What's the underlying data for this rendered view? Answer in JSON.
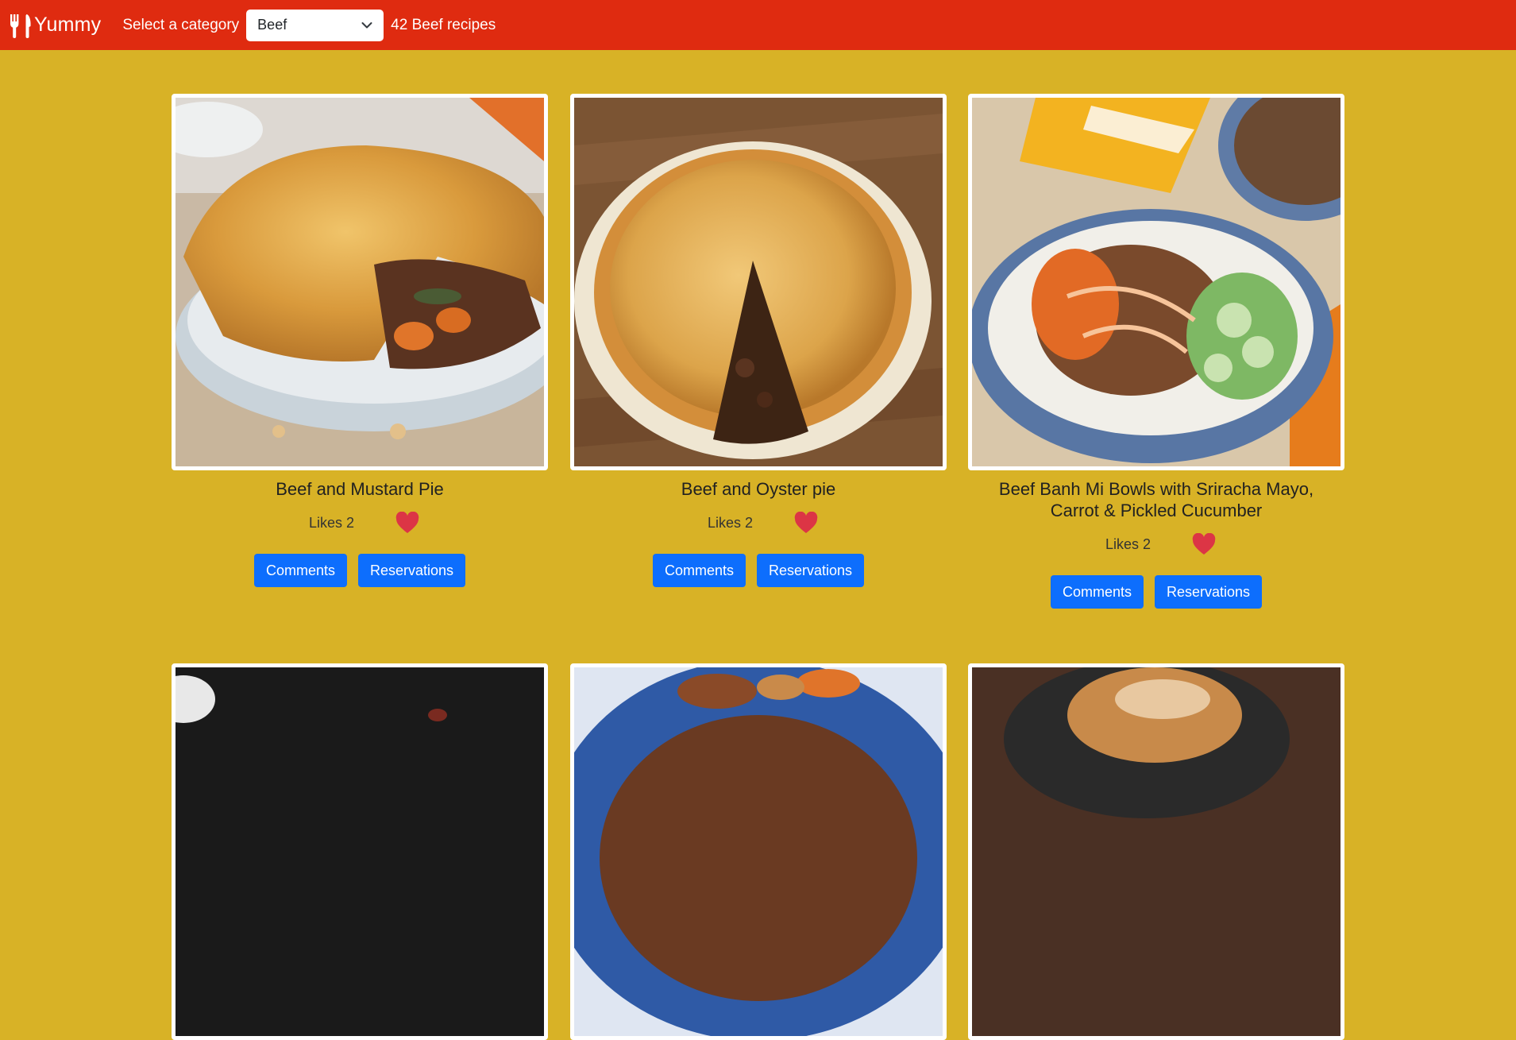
{
  "header": {
    "brand": "Yummy",
    "category_label": "Select a category",
    "category_selected": "Beef",
    "recipe_count_text": "42 Beef recipes",
    "colors": {
      "header_bg": "#df2b10",
      "page_bg": "#d8b226",
      "button": "#0d6efd",
      "heart": "#dc3545"
    }
  },
  "icons": {
    "logo": "fork-knife-icon",
    "dropdown": "chevron-down-icon",
    "like": "heart-icon"
  },
  "meals": [
    {
      "title": "Beef and Mustard Pie",
      "likes": "Likes 2",
      "comments_label": "Comments",
      "reservations_label": "Reservations"
    },
    {
      "title": "Beef and Oyster pie",
      "likes": "Likes 2",
      "comments_label": "Comments",
      "reservations_label": "Reservations"
    },
    {
      "title": "Beef Banh Mi Bowls with Sriracha Mayo, Carrot & Pickled Cucumber",
      "likes": "Likes 2",
      "comments_label": "Comments",
      "reservations_label": "Reservations"
    },
    {
      "title": ""
    },
    {
      "title": ""
    },
    {
      "title": ""
    }
  ]
}
